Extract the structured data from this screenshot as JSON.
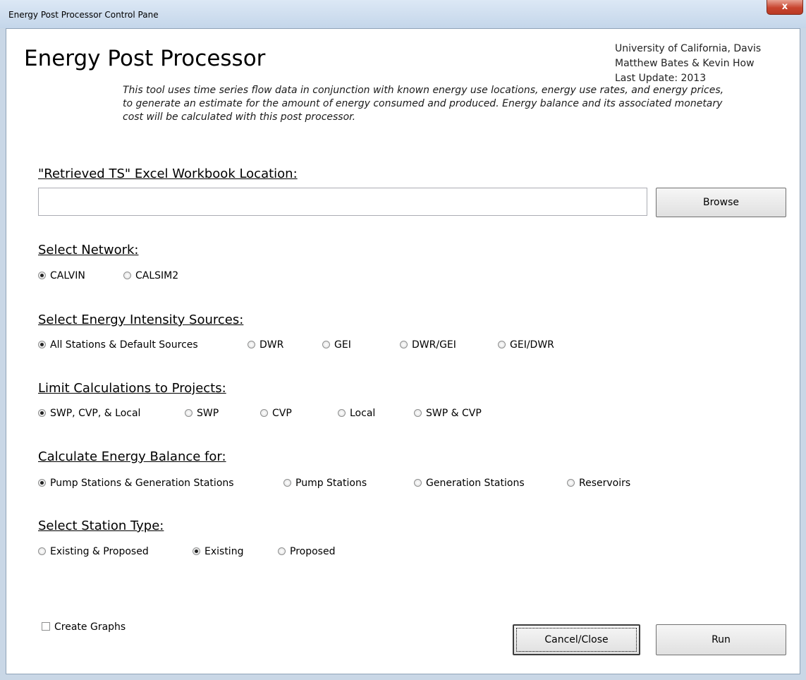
{
  "window": {
    "title": "Energy Post Processor Control Pane",
    "close_glyph": "x"
  },
  "header": {
    "heading": "Energy Post Processor",
    "credits": [
      "University of California, Davis",
      "Matthew Bates & Kevin How",
      "Last Update: 2013"
    ]
  },
  "description": "This tool uses time series flow data in conjunction with known energy use locations, energy use rates, and energy prices, to generate an estimate for the amount of energy consumed and produced.  Energy balance and its associated monetary cost will be calculated with this post processor.",
  "workbook": {
    "label": "\"Retrieved TS\" Excel Workbook Location:",
    "value": "",
    "browse_label": "Browse"
  },
  "sections": {
    "network": {
      "label": "Select Network:",
      "options": [
        {
          "label": "CALVIN",
          "checked": true
        },
        {
          "label": "CALSIM2",
          "checked": false
        }
      ]
    },
    "intensity": {
      "label": "Select Energy Intensity Sources:",
      "options": [
        {
          "label": "All Stations & Default Sources",
          "checked": true
        },
        {
          "label": "DWR",
          "checked": false
        },
        {
          "label": "GEI",
          "checked": false
        },
        {
          "label": "DWR/GEI",
          "checked": false
        },
        {
          "label": "GEI/DWR",
          "checked": false
        }
      ]
    },
    "projects": {
      "label": "Limit Calculations to Projects:",
      "options": [
        {
          "label": "SWP, CVP, & Local",
          "checked": true
        },
        {
          "label": "SWP",
          "checked": false
        },
        {
          "label": "CVP",
          "checked": false
        },
        {
          "label": "Local",
          "checked": false
        },
        {
          "label": "SWP & CVP",
          "checked": false
        }
      ]
    },
    "balance": {
      "label": "Calculate Energy Balance for:",
      "options": [
        {
          "label": "Pump Stations & Generation Stations",
          "checked": true
        },
        {
          "label": "Pump Stations",
          "checked": false
        },
        {
          "label": "Generation Stations",
          "checked": false
        },
        {
          "label": "Reservoirs",
          "checked": false
        }
      ]
    },
    "station_type": {
      "label": "Select Station Type:",
      "options": [
        {
          "label": "Existing & Proposed",
          "checked": false
        },
        {
          "label": "Existing",
          "checked": true
        },
        {
          "label": "Proposed",
          "checked": false
        }
      ]
    }
  },
  "create_graphs": {
    "label": "Create Graphs",
    "checked": false
  },
  "buttons": {
    "cancel_label": "Cancel/Close",
    "run_label": "Run"
  },
  "colors": {
    "close_button": "#c8452f",
    "titlebar": "#c9d7e6"
  }
}
